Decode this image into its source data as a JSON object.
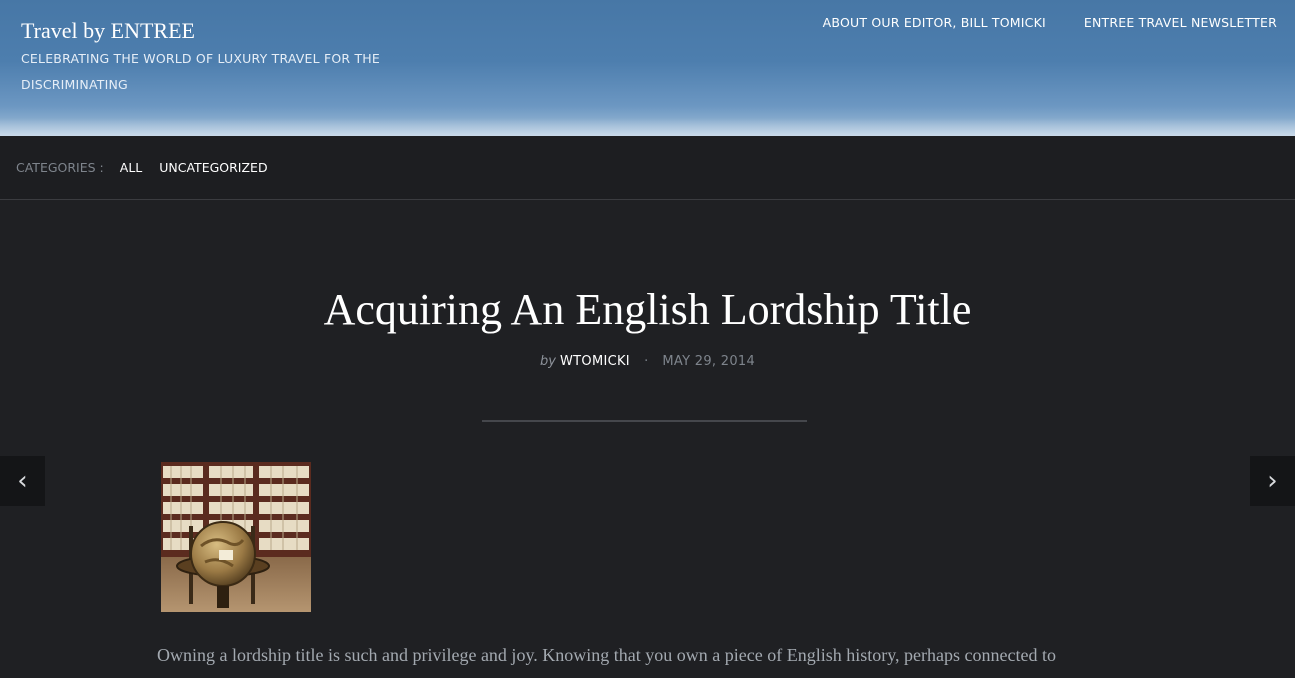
{
  "site": {
    "title": "Travel by ENTREE",
    "tagline": "CELEBRATING THE WORLD OF LUXURY TRAVEL FOR THE DISCRIMINATING"
  },
  "top_nav": {
    "items": [
      {
        "label": "ABOUT OUR EDITOR, BILL TOMICKI"
      },
      {
        "label": "ENTREE TRAVEL NEWSLETTER"
      }
    ]
  },
  "categories": {
    "label": "CATEGORIES :",
    "items": [
      {
        "label": "ALL"
      },
      {
        "label": "UNCATEGORIZED"
      }
    ]
  },
  "post": {
    "title": "Acquiring An English Lordship Title",
    "by": "by",
    "author": "WTOMICKI",
    "separator": "·",
    "date": "MAY 29, 2014",
    "excerpt": "Owning a lordship title is such and privilege and joy. Knowing that you own a piece of English history, perhaps connected to"
  },
  "navigation": {
    "prev_icon": "‹",
    "next_icon": "›"
  },
  "colors": {
    "header_blue": "#4d7eae",
    "background": "#1f2023",
    "meta_gray": "#7e848c"
  }
}
